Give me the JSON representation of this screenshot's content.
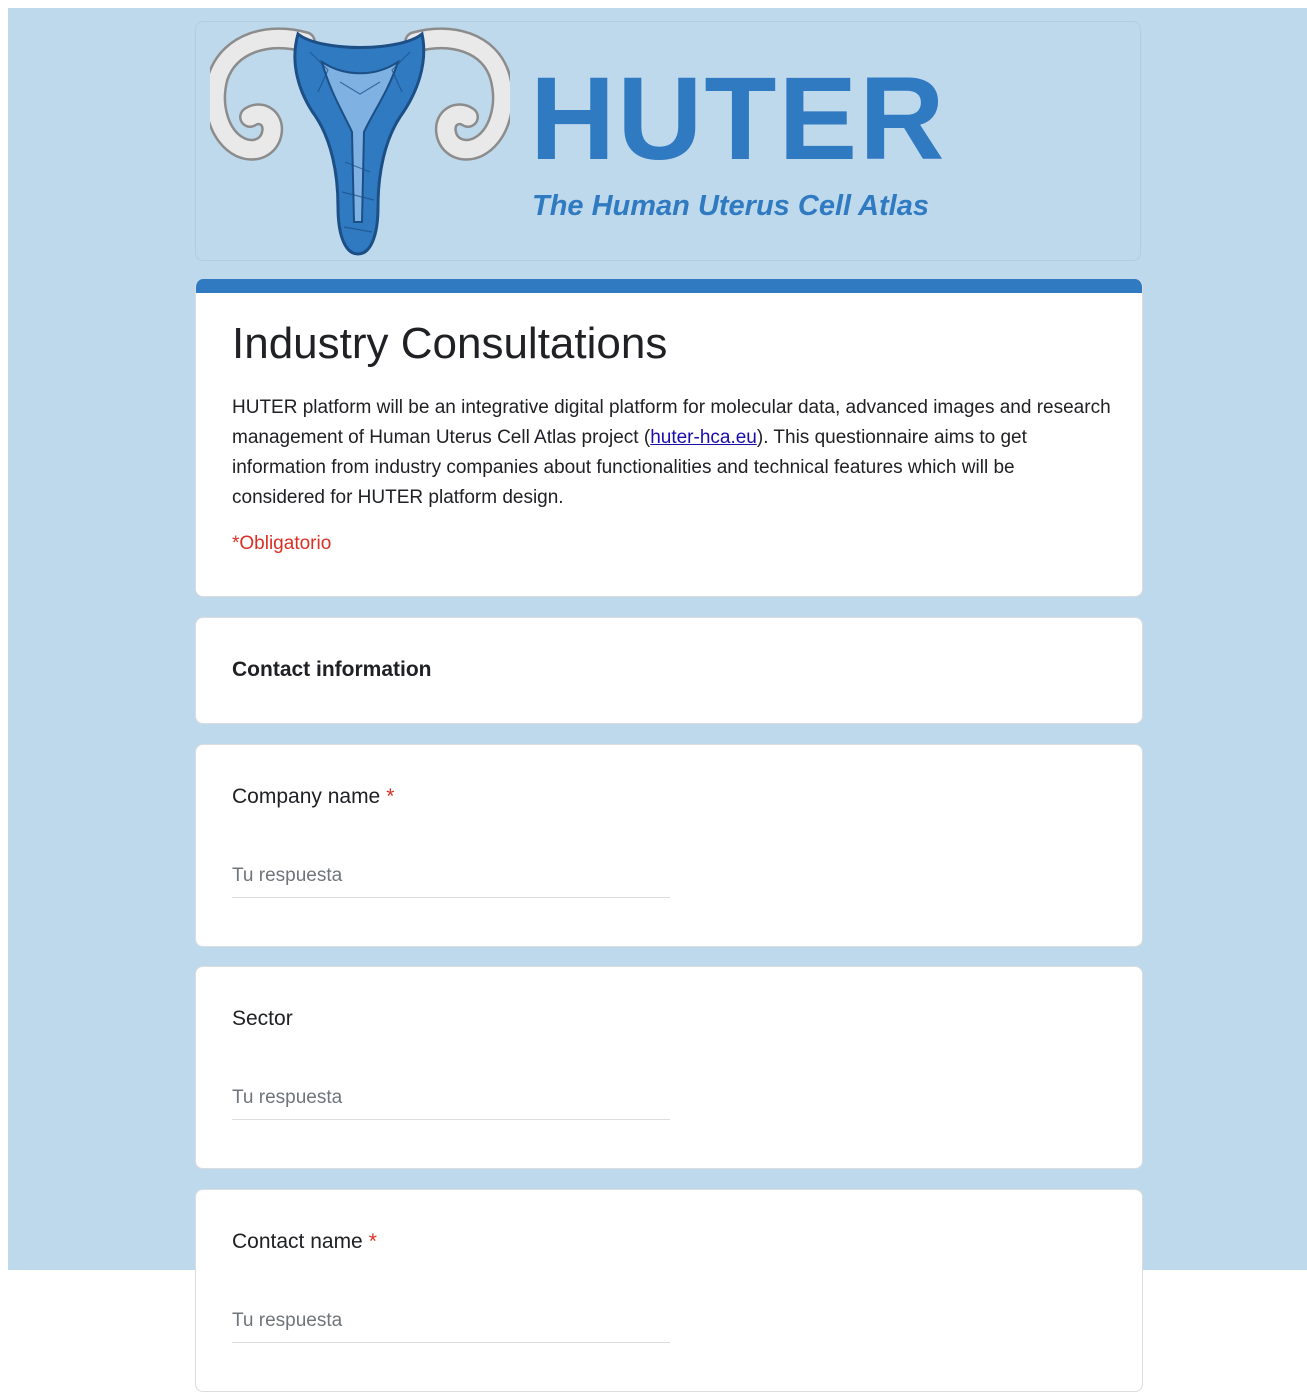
{
  "banner": {
    "title": "HUTER",
    "subtitle": "The Human Uterus Cell Atlas"
  },
  "form": {
    "title": "Industry Consultations",
    "description_before_link": "HUTER platform will be an integrative digital platform for molecular data, advanced images and research management of Human Uterus Cell Atlas project (",
    "link_text": "huter-hca.eu",
    "description_after_link": "). This questionnaire aims to get information from industry companies about functionalities and technical features which will be considered for HUTER platform design.",
    "required_note": "*Obligatorio"
  },
  "section": {
    "title": "Contact information"
  },
  "questions": [
    {
      "label": "Company name",
      "required_mark": "*",
      "placeholder": "Tu respuesta"
    },
    {
      "label": "Sector",
      "required_mark": "",
      "placeholder": "Tu respuesta"
    },
    {
      "label": "Contact name",
      "required_mark": "*",
      "placeholder": "Tu respuesta"
    }
  ],
  "colors": {
    "page_background": "#bfd9ec",
    "accent": "#2f7ac1",
    "required": "#d93025",
    "link": "#1a0dab"
  },
  "icons": [
    "uterus-logo-icon"
  ]
}
